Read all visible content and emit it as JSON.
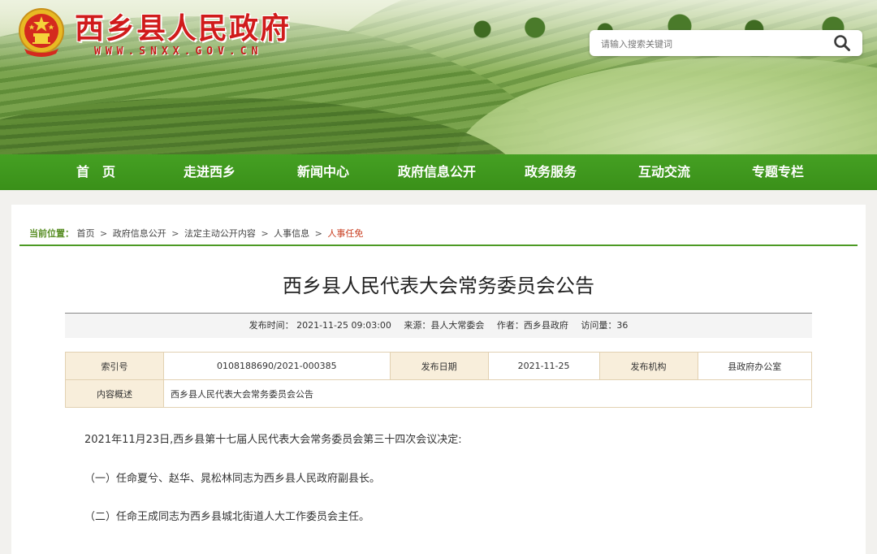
{
  "site": {
    "title": "西乡县人民政府",
    "url": "WWW.SNXX.GOV.CN",
    "search_placeholder": "请输入搜索关键词"
  },
  "nav": {
    "items": [
      "首　页",
      "走进西乡",
      "新闻中心",
      "政府信息公开",
      "政务服务",
      "互动交流",
      "专题专栏"
    ]
  },
  "breadcrumb": {
    "label": "当前位置：",
    "items": [
      "首页",
      "政府信息公开",
      "法定主动公开内容",
      "人事信息"
    ],
    "current": "人事任免",
    "separator": ">"
  },
  "article": {
    "title": "西乡县人民代表大会常务委员会公告",
    "meta": {
      "publish_time": "发布时间： 2021-11-25 09:03:00",
      "source": "来源：县人大常委会",
      "author": "作者：西乡县政府",
      "views": "访问量：36"
    },
    "info": {
      "index_label": "索引号",
      "index_value": "0108188690/2021-000385",
      "date_label": "发布日期",
      "date_value": "2021-11-25",
      "org_label": "发布机构",
      "org_value": "县政府办公室",
      "summary_label": "内容概述",
      "summary_value": "西乡县人民代表大会常务委员会公告"
    },
    "paragraphs": [
      "2021年11月23日,西乡县第十七届人民代表大会常务委员会第三十四次会议决定:",
      "（一）任命夏兮、赵华、晁松林同志为西乡县人民政府副县长。",
      "（二）任命王成同志为西乡县城北街道人大工作委员会主任。"
    ]
  },
  "colors": {
    "title_red": "#d01b1b",
    "nav_green": "#3f9a1e",
    "crumb_current": "#c83b1d",
    "table_key_bg": "#f8eedb"
  },
  "icons": {
    "emblem": "national-emblem-icon",
    "search": "search-icon"
  }
}
